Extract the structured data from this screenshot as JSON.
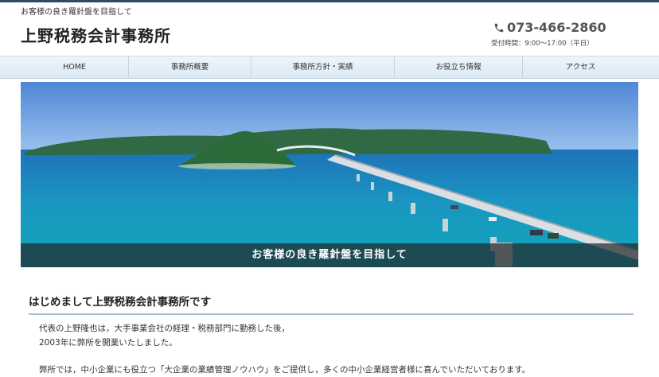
{
  "header": {
    "tagline": "お客様の良き羅針盤を目指して",
    "site_title": "上野税務会計事務所",
    "phone": "073-466-2860",
    "hours": "受付時間：9:00〜17:00（平日）"
  },
  "nav": {
    "items": [
      {
        "label": "HOME"
      },
      {
        "label": "事務所概要"
      },
      {
        "label": "事務所方針・実績"
      },
      {
        "label": "お役立ち情報"
      },
      {
        "label": "アクセス"
      }
    ]
  },
  "hero": {
    "caption": "お客様の良き羅針盤を目指して"
  },
  "content": {
    "heading": "はじめまして上野税務会計事務所です",
    "paragraph1_line1": "代表の上野隆也は，大手事業会社の経理・税務部門に勤務した後，",
    "paragraph1_line2": "2003年に弊所を開業いたしました。",
    "paragraph2_line1": "弊所では，中小企業にも役立つ「大企業の業績管理ノウハウ」をご提供し，多くの中小企業経営者様に喜んでいただいております。"
  },
  "colors": {
    "topbar": "#2e4a66",
    "nav_bg": "#dce9f4",
    "heading_rule": "#a8bfd6"
  }
}
